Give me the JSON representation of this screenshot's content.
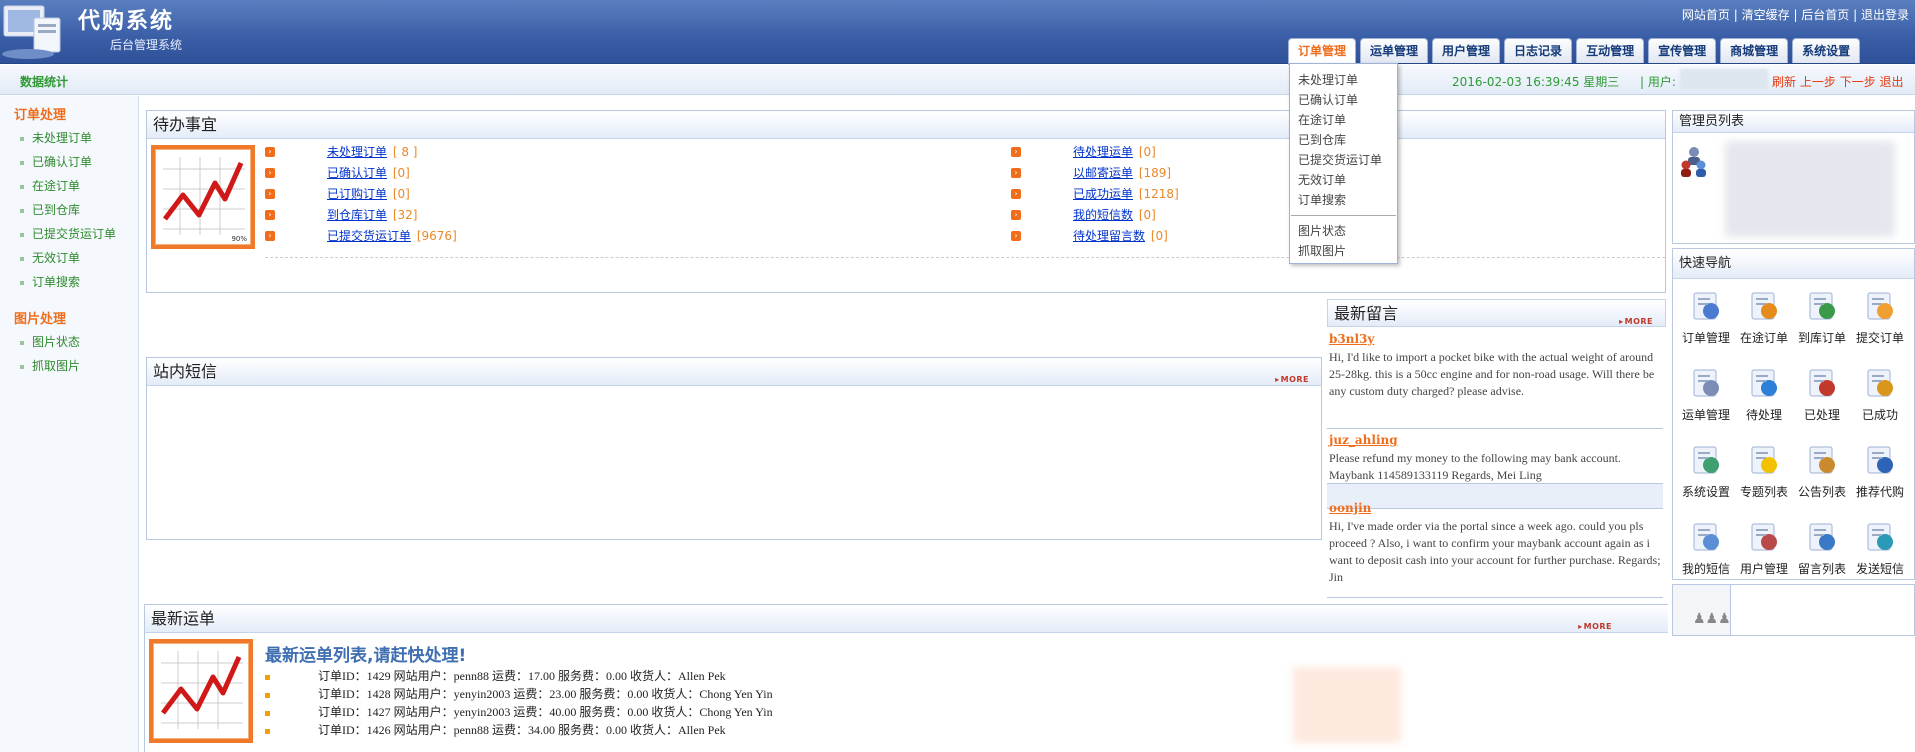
{
  "header": {
    "title": "代购系统",
    "subtitle": "后台管理系统",
    "top_links": [
      "网站首页",
      "清空缓存",
      "后台首页",
      "退出登录"
    ]
  },
  "tabs": [
    {
      "label": "订单管理",
      "active": true
    },
    {
      "label": "运单管理"
    },
    {
      "label": "用户管理"
    },
    {
      "label": "日志记录"
    },
    {
      "label": "互动管理"
    },
    {
      "label": "宣传管理"
    },
    {
      "label": "商城管理"
    },
    {
      "label": "系统设置"
    }
  ],
  "subbar": {
    "stat_label": "数据统计",
    "datetime": "2016-02-03 16:39:45 星期三",
    "user_label": "| 用户:",
    "actions": [
      "刷新",
      "上一步",
      "下一步",
      "退出"
    ]
  },
  "sidebar": {
    "sections": [
      {
        "title": "订单处理",
        "items": [
          "未处理订单",
          "已确认订单",
          "在途订单",
          "已到仓库",
          "已提交货运订单",
          "无效订单",
          "订单搜索"
        ]
      },
      {
        "title": "图片处理",
        "items": [
          "图片状态",
          "抓取图片"
        ]
      }
    ]
  },
  "dropdown": {
    "items": [
      "未处理订单",
      "已确认订单",
      "在途订单",
      "已到仓库",
      "已提交货运订单",
      "无效订单",
      "订单搜索",
      "图片状态",
      "抓取图片"
    ]
  },
  "todo": {
    "title": "待办事宜",
    "left": [
      {
        "label": "未处理订单",
        "count": "[ 8 ]"
      },
      {
        "label": "已确认订单",
        "count": "[0]"
      },
      {
        "label": "已订购订单",
        "count": "[0]"
      },
      {
        "label": "到仓库订单",
        "count": "[32]"
      },
      {
        "label": "已提交货运订单",
        "count": "[9676]"
      }
    ],
    "right": [
      {
        "label": "待处理运单",
        "count": "[0]"
      },
      {
        "label": "以邮寄运单",
        "count": "[189]"
      },
      {
        "label": "已成功运单",
        "count": "[1218]"
      },
      {
        "label": "我的短信数",
        "count": "[0]"
      },
      {
        "label": "待处理留言数",
        "count": "[0]"
      }
    ],
    "icon_label": "90%"
  },
  "sms_panel": {
    "title": "站内短信",
    "more": "MORE"
  },
  "messages": {
    "title": "最新留言",
    "more": "MORE",
    "items": [
      {
        "user": "b3nl3y",
        "text": "Hi, I'd like to import a pocket bike with the actual weight of around 25-28kg. this is a 50cc engine and for non-road usage. Will there be any custom duty charged? please advise."
      },
      {
        "user": "juz_ahling",
        "text": "Please refund my money to the following may bank account. Maybank 114589133119 Regards, Mei Ling"
      },
      {
        "user": "oonjin",
        "text": "Hi, I've made order via the portal since a week ago. could you pls proceed ? Also, i want to confirm your maybank account again as i want to deposit cash into your account for further purchase. Regards; Jin"
      }
    ]
  },
  "admin_panel": {
    "title": "管理员列表"
  },
  "quick_nav": {
    "title": "快速导航",
    "items": [
      {
        "label": "订单管理",
        "icon": "order-icon"
      },
      {
        "label": "在途订单",
        "icon": "transit-icon"
      },
      {
        "label": "到库订单",
        "icon": "warehouse-icon"
      },
      {
        "label": "提交订单",
        "icon": "submit-icon"
      },
      {
        "label": "运单管理",
        "icon": "waybill-icon"
      },
      {
        "label": "待处理",
        "icon": "pending-icon"
      },
      {
        "label": "已处理",
        "icon": "processed-icon"
      },
      {
        "label": "已成功",
        "icon": "success-icon"
      },
      {
        "label": "系统设置",
        "icon": "settings-icon"
      },
      {
        "label": "专题列表",
        "icon": "star-icon"
      },
      {
        "label": "公告列表",
        "icon": "notice-icon"
      },
      {
        "label": "推荐代购",
        "icon": "recommend-icon"
      },
      {
        "label": "我的短信",
        "icon": "sms-icon"
      },
      {
        "label": "用户管理",
        "icon": "users-icon"
      },
      {
        "label": "留言列表",
        "icon": "comments-icon"
      },
      {
        "label": "发送短信",
        "icon": "send-sms-icon"
      }
    ]
  },
  "orders": {
    "title": "最新运单",
    "more": "MORE",
    "subtitle": "最新运单列表,请赶快处理!",
    "rows": [
      {
        "text": "订单ID：1429 网站用户：penn88 运费：17.00 服务费：0.00 收货人：Allen Pek"
      },
      {
        "text": "订单ID：1428 网站用户：yenyin2003 运费：23.00 服务费：0.00 收货人：Chong Yen Yin"
      },
      {
        "text": "订单ID：1427 网站用户：yenyin2003 运费：40.00 服务费：0.00 收货人：Chong Yen Yin"
      },
      {
        "text": "订单ID：1426 网站用户：penn88 运费：34.00 服务费：0.00 收货人：Allen Pek"
      }
    ]
  },
  "colors": {
    "accent": "#f06d1b",
    "header": "#3a5ea6",
    "green": "#2f9a35",
    "link": "#0033cc"
  }
}
